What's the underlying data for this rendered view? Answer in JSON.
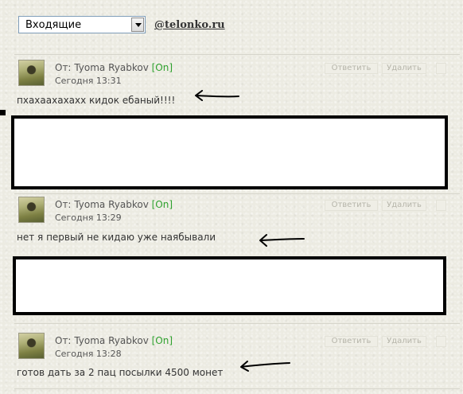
{
  "folder_select": {
    "value": "Входящие"
  },
  "header_link": "@telonko.ru",
  "labels": {
    "from_prefix": "От:",
    "reply": "Ответить",
    "delete": "Удалить"
  },
  "colors": {
    "online": "#2ea12e",
    "background": "#ecebe2",
    "text": "#333333"
  },
  "icons": {
    "close": "close-icon",
    "select_arrow": "chevron-down-icon",
    "annotation": "hand-drawn-arrow-icon"
  },
  "messages": [
    {
      "sender": "Tyoma Ryabkov",
      "status": "[On]",
      "date": "Сегодня 13:31",
      "text": "пхахаахахахх кидок ебаный!!!!"
    },
    {
      "sender": "Tyoma Ryabkov",
      "status": "[On]",
      "date": "Сегодня 13:29",
      "text": "нет я первый не кидаю уже наябывали"
    },
    {
      "sender": "Tyoma Ryabkov",
      "status": "[On]",
      "date": "Сегодня 13:28",
      "text": "готов дать за 2 пац посылки 4500 монет"
    }
  ]
}
